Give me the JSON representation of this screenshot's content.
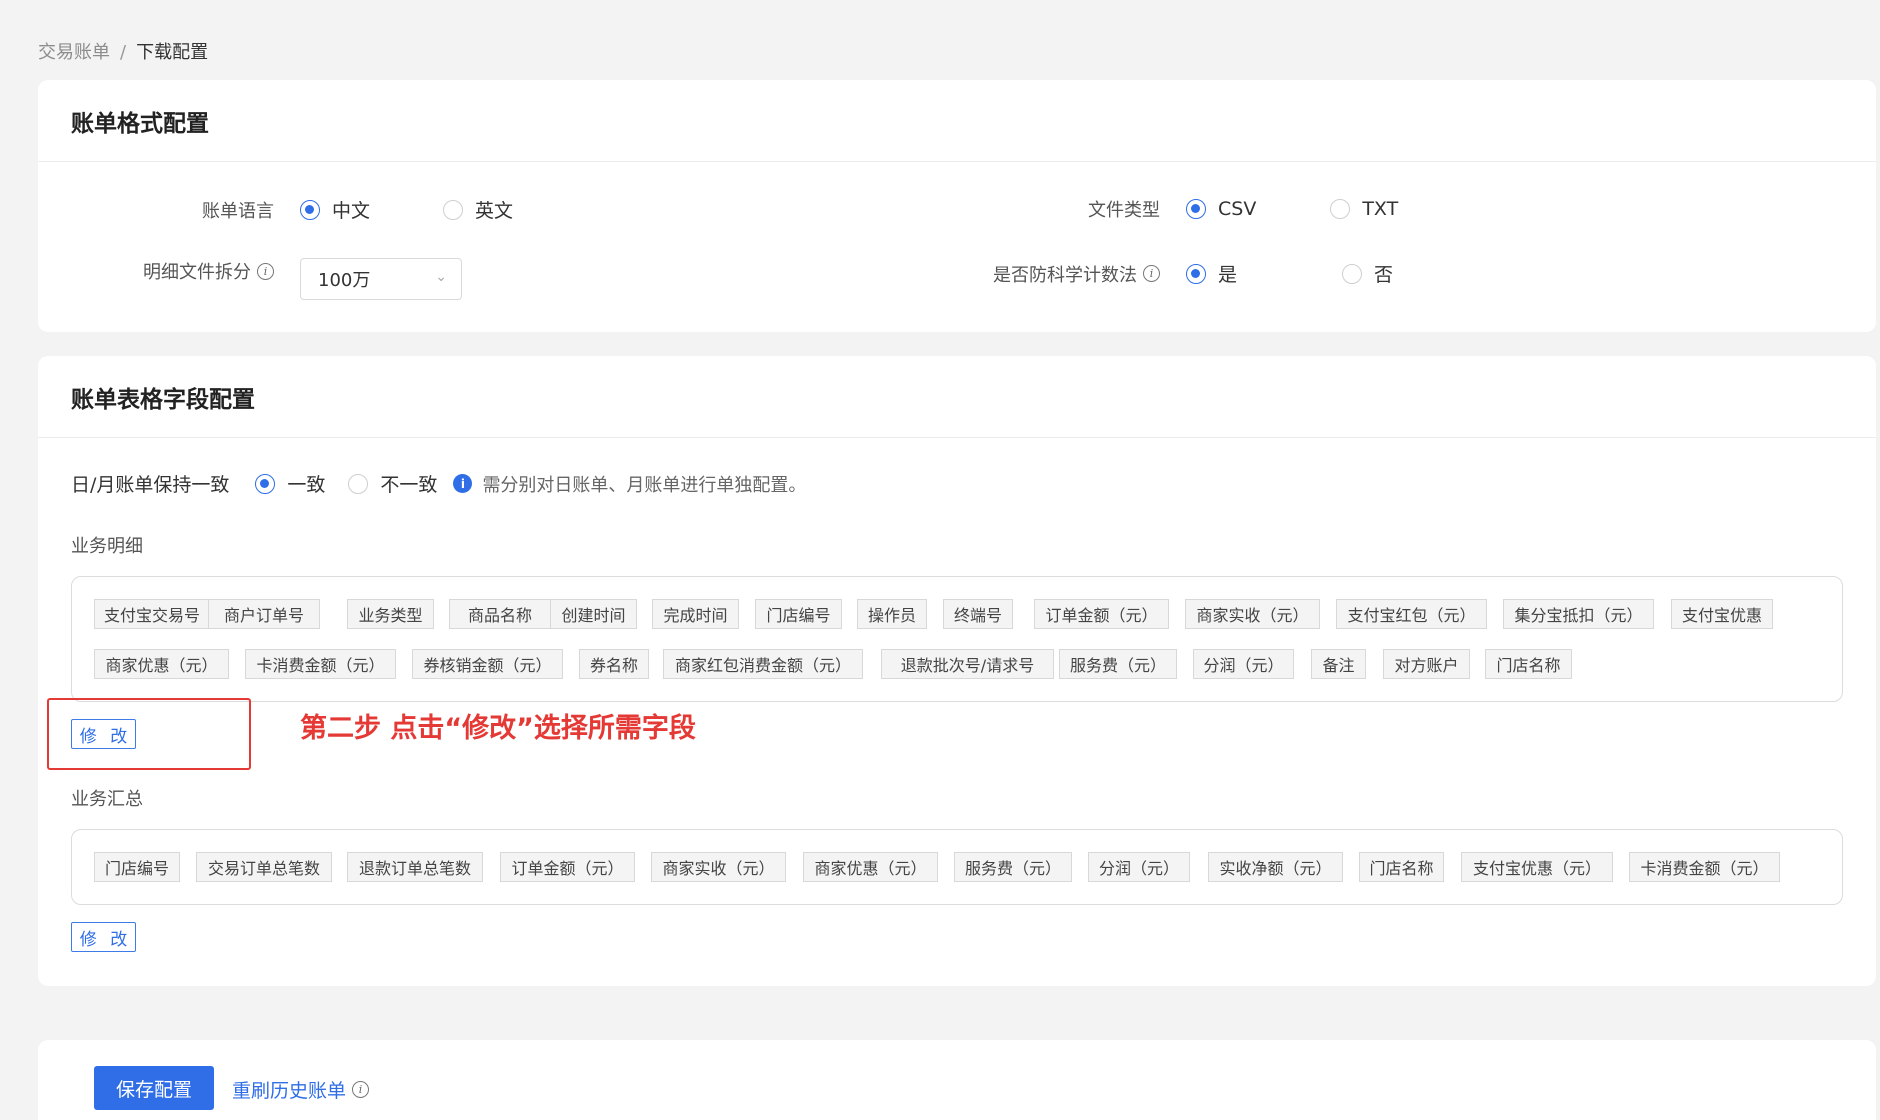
{
  "breadcrumb": {
    "parent": "交易账单",
    "separator": "/",
    "current": "下载配置"
  },
  "format_card": {
    "title": "账单格式配置",
    "language": {
      "label": "账单语言",
      "options": [
        "中文",
        "英文"
      ],
      "selected": "中文"
    },
    "file_type": {
      "label": "文件类型",
      "options": [
        "CSV",
        "TXT"
      ],
      "selected": "CSV"
    },
    "split": {
      "label": "明细文件拆分",
      "value": "100万"
    },
    "sci_notation": {
      "label": "是否防科学计数法",
      "options": [
        "是",
        "否"
      ],
      "selected": "是"
    }
  },
  "fields_card": {
    "title": "账单表格字段配置",
    "consistency": {
      "label": "日/月账单保持一致",
      "options": [
        "一致",
        "不一致"
      ],
      "selected": "一致",
      "hint": "需分别对日账单、月账单进行单独配置。"
    },
    "detail": {
      "label": "业务明细",
      "tags": [
        "支付宝交易号",
        "商户订单号",
        "业务类型",
        "商品名称",
        "创建时间",
        "完成时间",
        "门店编号",
        "操作员",
        "终端号",
        "订单金额（元）",
        "商家实收（元）",
        "支付宝红包（元）",
        "集分宝抵扣（元）",
        "支付宝优惠",
        "商家优惠（元）",
        "卡消费金额（元）",
        "券核销金额（元）",
        "券名称",
        "商家红包消费金额（元）",
        "退款批次号/请求号",
        "服务费（元）",
        "分润（元）",
        "备注",
        "对方账户",
        "门店名称"
      ],
      "edit_label": "修 改"
    },
    "summary": {
      "label": "业务汇总",
      "tags": [
        "门店编号",
        "交易订单总笔数",
        "退款订单总笔数",
        "订单金额（元）",
        "商家实收（元）",
        "商家优惠（元）",
        "服务费（元）",
        "分润（元）",
        "实收净额（元）",
        "门店名称",
        "支付宝优惠（元）",
        "卡消费金额（元）"
      ],
      "edit_label": "修 改"
    },
    "annotation": "第二步  点击“修改”选择所需字段"
  },
  "footer": {
    "save_label": "保存配置",
    "refresh_label": "重刷历史账单"
  },
  "colors": {
    "primary": "#2f6ee6",
    "annotation": "#e53935"
  }
}
